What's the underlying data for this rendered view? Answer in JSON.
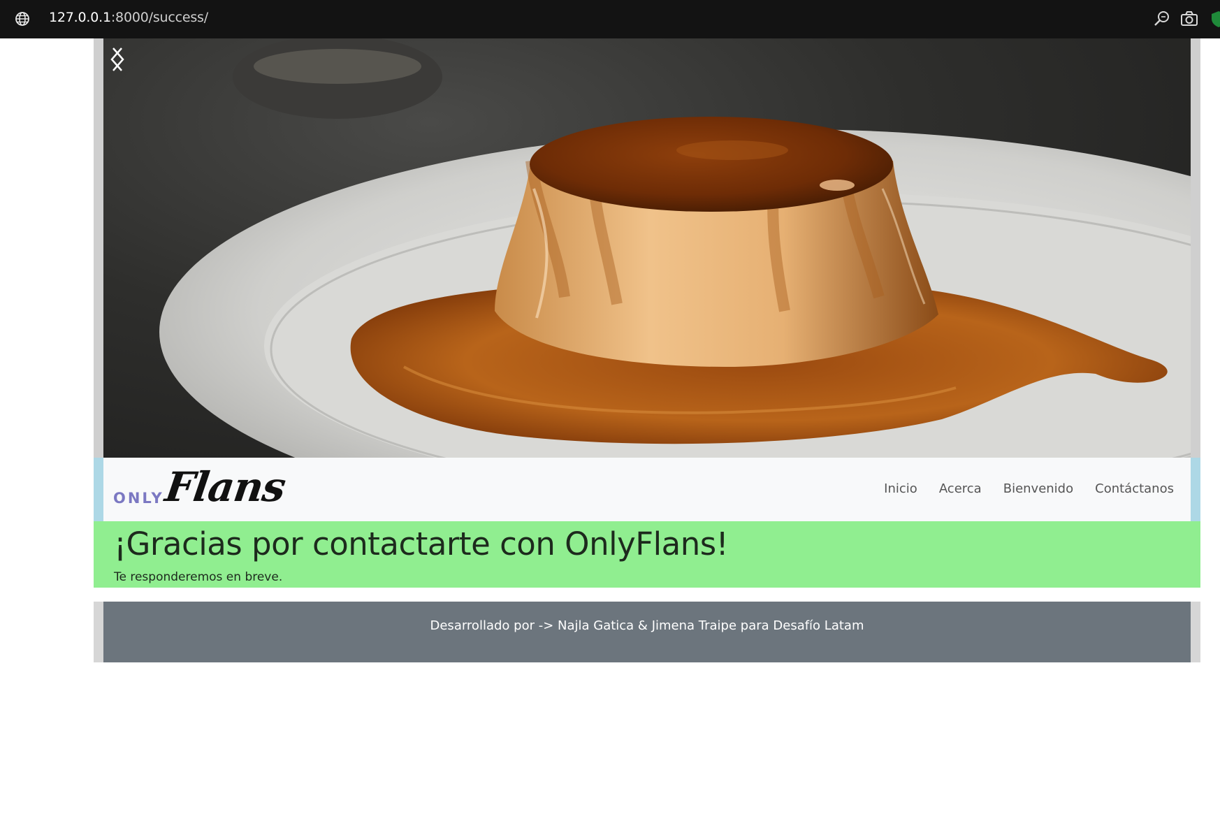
{
  "browser": {
    "url_host": "127.0.0.1",
    "url_rest": ":8000/success/",
    "icons": [
      "globe-icon",
      "zoom-icon",
      "camera-icon",
      "shield-icon"
    ]
  },
  "carousel": {
    "image_alt": "Flan con caramelo",
    "prev_icon": "chevron-left-icon",
    "next_icon": "chevron-right-icon"
  },
  "navbar": {
    "brand_only": "ONLY",
    "brand_flans": "Flans",
    "links": [
      "Inicio",
      "Acerca",
      "Bienvenido",
      "Contáctanos"
    ]
  },
  "message": {
    "title": "¡Gracias por contactarte con OnlyFlans!",
    "subtitle": "Te responderemos en breve."
  },
  "footer": {
    "text": "Desarrollado por -> Najla Gatica & Jimena Traipe para Desafío Latam"
  },
  "colors": {
    "navbar_band": "#add8e6",
    "message_bg": "#90ee90",
    "footer_bg": "#6c757d",
    "brand_accent": "#7b78c2"
  }
}
